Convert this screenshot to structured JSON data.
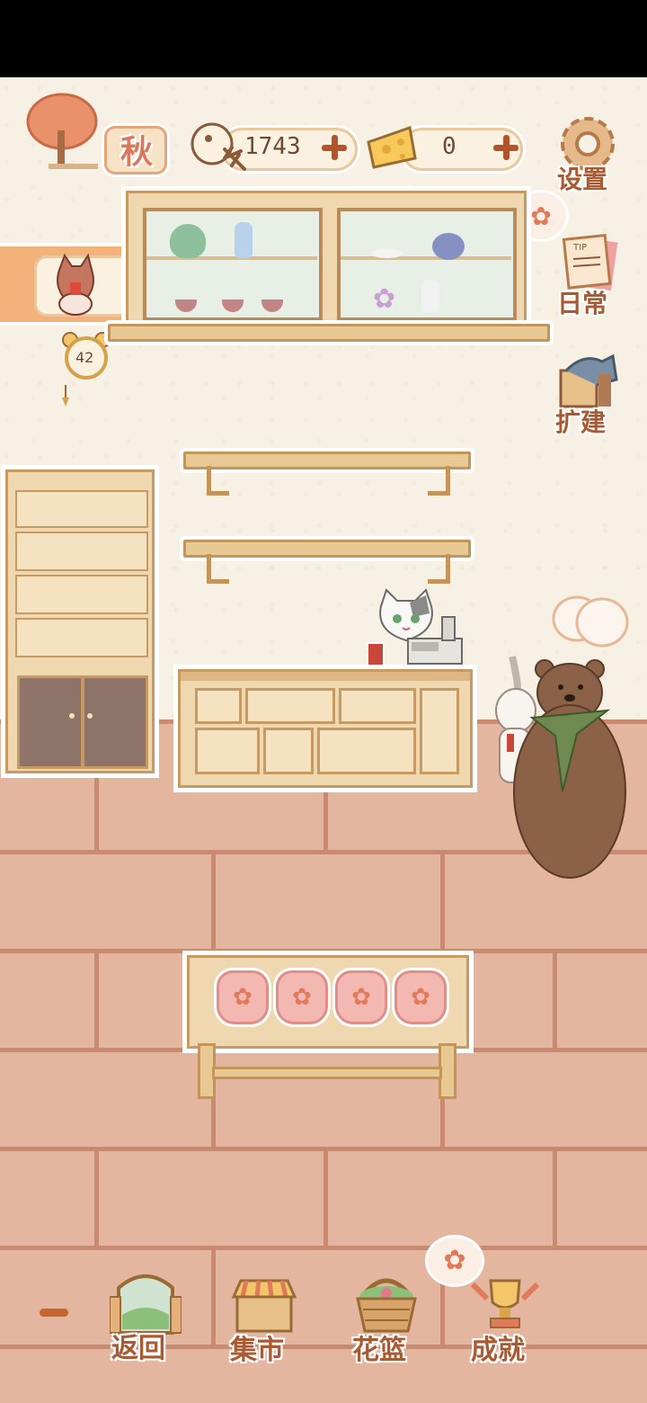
{
  "season": {
    "label": "秋"
  },
  "resources": {
    "fish": {
      "value": "1743",
      "icon": "fish-bone-icon"
    },
    "cheese": {
      "value": "0",
      "icon": "cheese-icon"
    }
  },
  "side_menu": {
    "settings": {
      "label": "设置",
      "icon": "gear-icon"
    },
    "daily": {
      "label": "日常",
      "icon": "notepad-icon"
    },
    "expand": {
      "label": "扩建",
      "icon": "paint-bucket-icon"
    }
  },
  "daily_note_tab": "TIP",
  "timer": {
    "value": "42"
  },
  "bottom_nav": [
    {
      "label": "返回",
      "icon": "window-icon"
    },
    {
      "label": "集市",
      "icon": "market-stall-icon"
    },
    {
      "label": "花篮",
      "icon": "flower-basket-icon"
    },
    {
      "label": "成就",
      "icon": "trophy-icon"
    }
  ],
  "colors": {
    "accent": "#a85a32",
    "wall": "#f7f0e4",
    "floor": "#e4b59f",
    "mortar": "#c98a70"
  }
}
